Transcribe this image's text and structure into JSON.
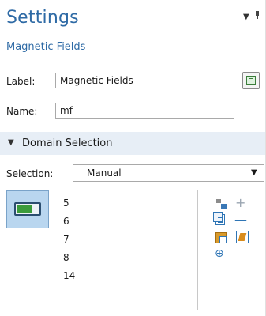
{
  "header": {
    "title": "Settings",
    "subtitle": "Magnetic Fields"
  },
  "form": {
    "label_caption": "Label:",
    "label_value": "Magnetic Fields",
    "name_caption": "Name:",
    "name_value": "mf"
  },
  "section": {
    "title": "Domain Selection"
  },
  "selection": {
    "caption": "Selection:",
    "value": "Manual",
    "items": [
      "5",
      "6",
      "7",
      "8",
      "14"
    ]
  },
  "colors": {
    "title_blue": "#2e6aa5",
    "section_bg": "#e7eef6",
    "toggle_bg": "#b9d6ef"
  },
  "icons": [
    "pin-icon",
    "label-edit-icon",
    "active-toggle-icon",
    "paste-selection-icon",
    "add-icon",
    "copy-icon",
    "remove-icon",
    "paste-icon",
    "clear-icon",
    "zoom-to-selection-icon"
  ]
}
